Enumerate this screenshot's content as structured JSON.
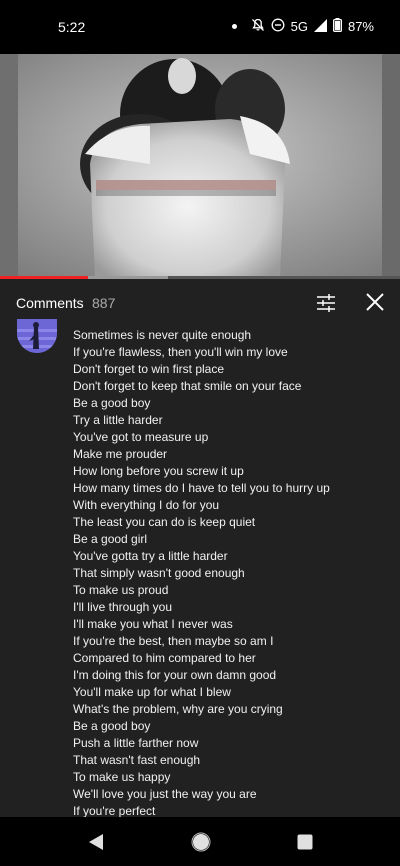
{
  "status_bar": {
    "time": "5:22",
    "network": "5G",
    "battery": "87%"
  },
  "video": {
    "progress_fraction": 0.22,
    "buffer_fraction": 0.42
  },
  "comments": {
    "title": "Comments",
    "count": "887",
    "lyrics": [
      "Sometimes is never quite enough",
      "If you're flawless, then you'll win my love",
      "Don't forget to win first place",
      "Don't forget to keep that smile on your face",
      "Be a good boy",
      "Try a little harder",
      "You've got to measure up",
      "Make me prouder",
      "How long before you screw it up",
      "How many times do I have to tell you to hurry up",
      "With everything I do for you",
      "The least you can do is keep quiet",
      "Be a good girl",
      "You've gotta try a little harder",
      "That simply wasn't good enough",
      "To make us proud",
      "I'll live through you",
      "I'll make you what I never was",
      "If you're the best, then maybe so am I",
      "Compared to him compared to her",
      "I'm doing this for your own damn good",
      "You'll make up for what I blew",
      "What's the problem, why are you crying",
      "Be a good boy",
      "Push a little farther now",
      "That wasn't fast enough",
      "To make us happy",
      "We'll love you just the way you are",
      "If you're perfect"
    ]
  },
  "icons": {
    "filter": "sliders-icon",
    "close": "close-icon",
    "back": "back-triangle-icon",
    "home": "home-circle-icon",
    "recent": "recents-square-icon"
  }
}
